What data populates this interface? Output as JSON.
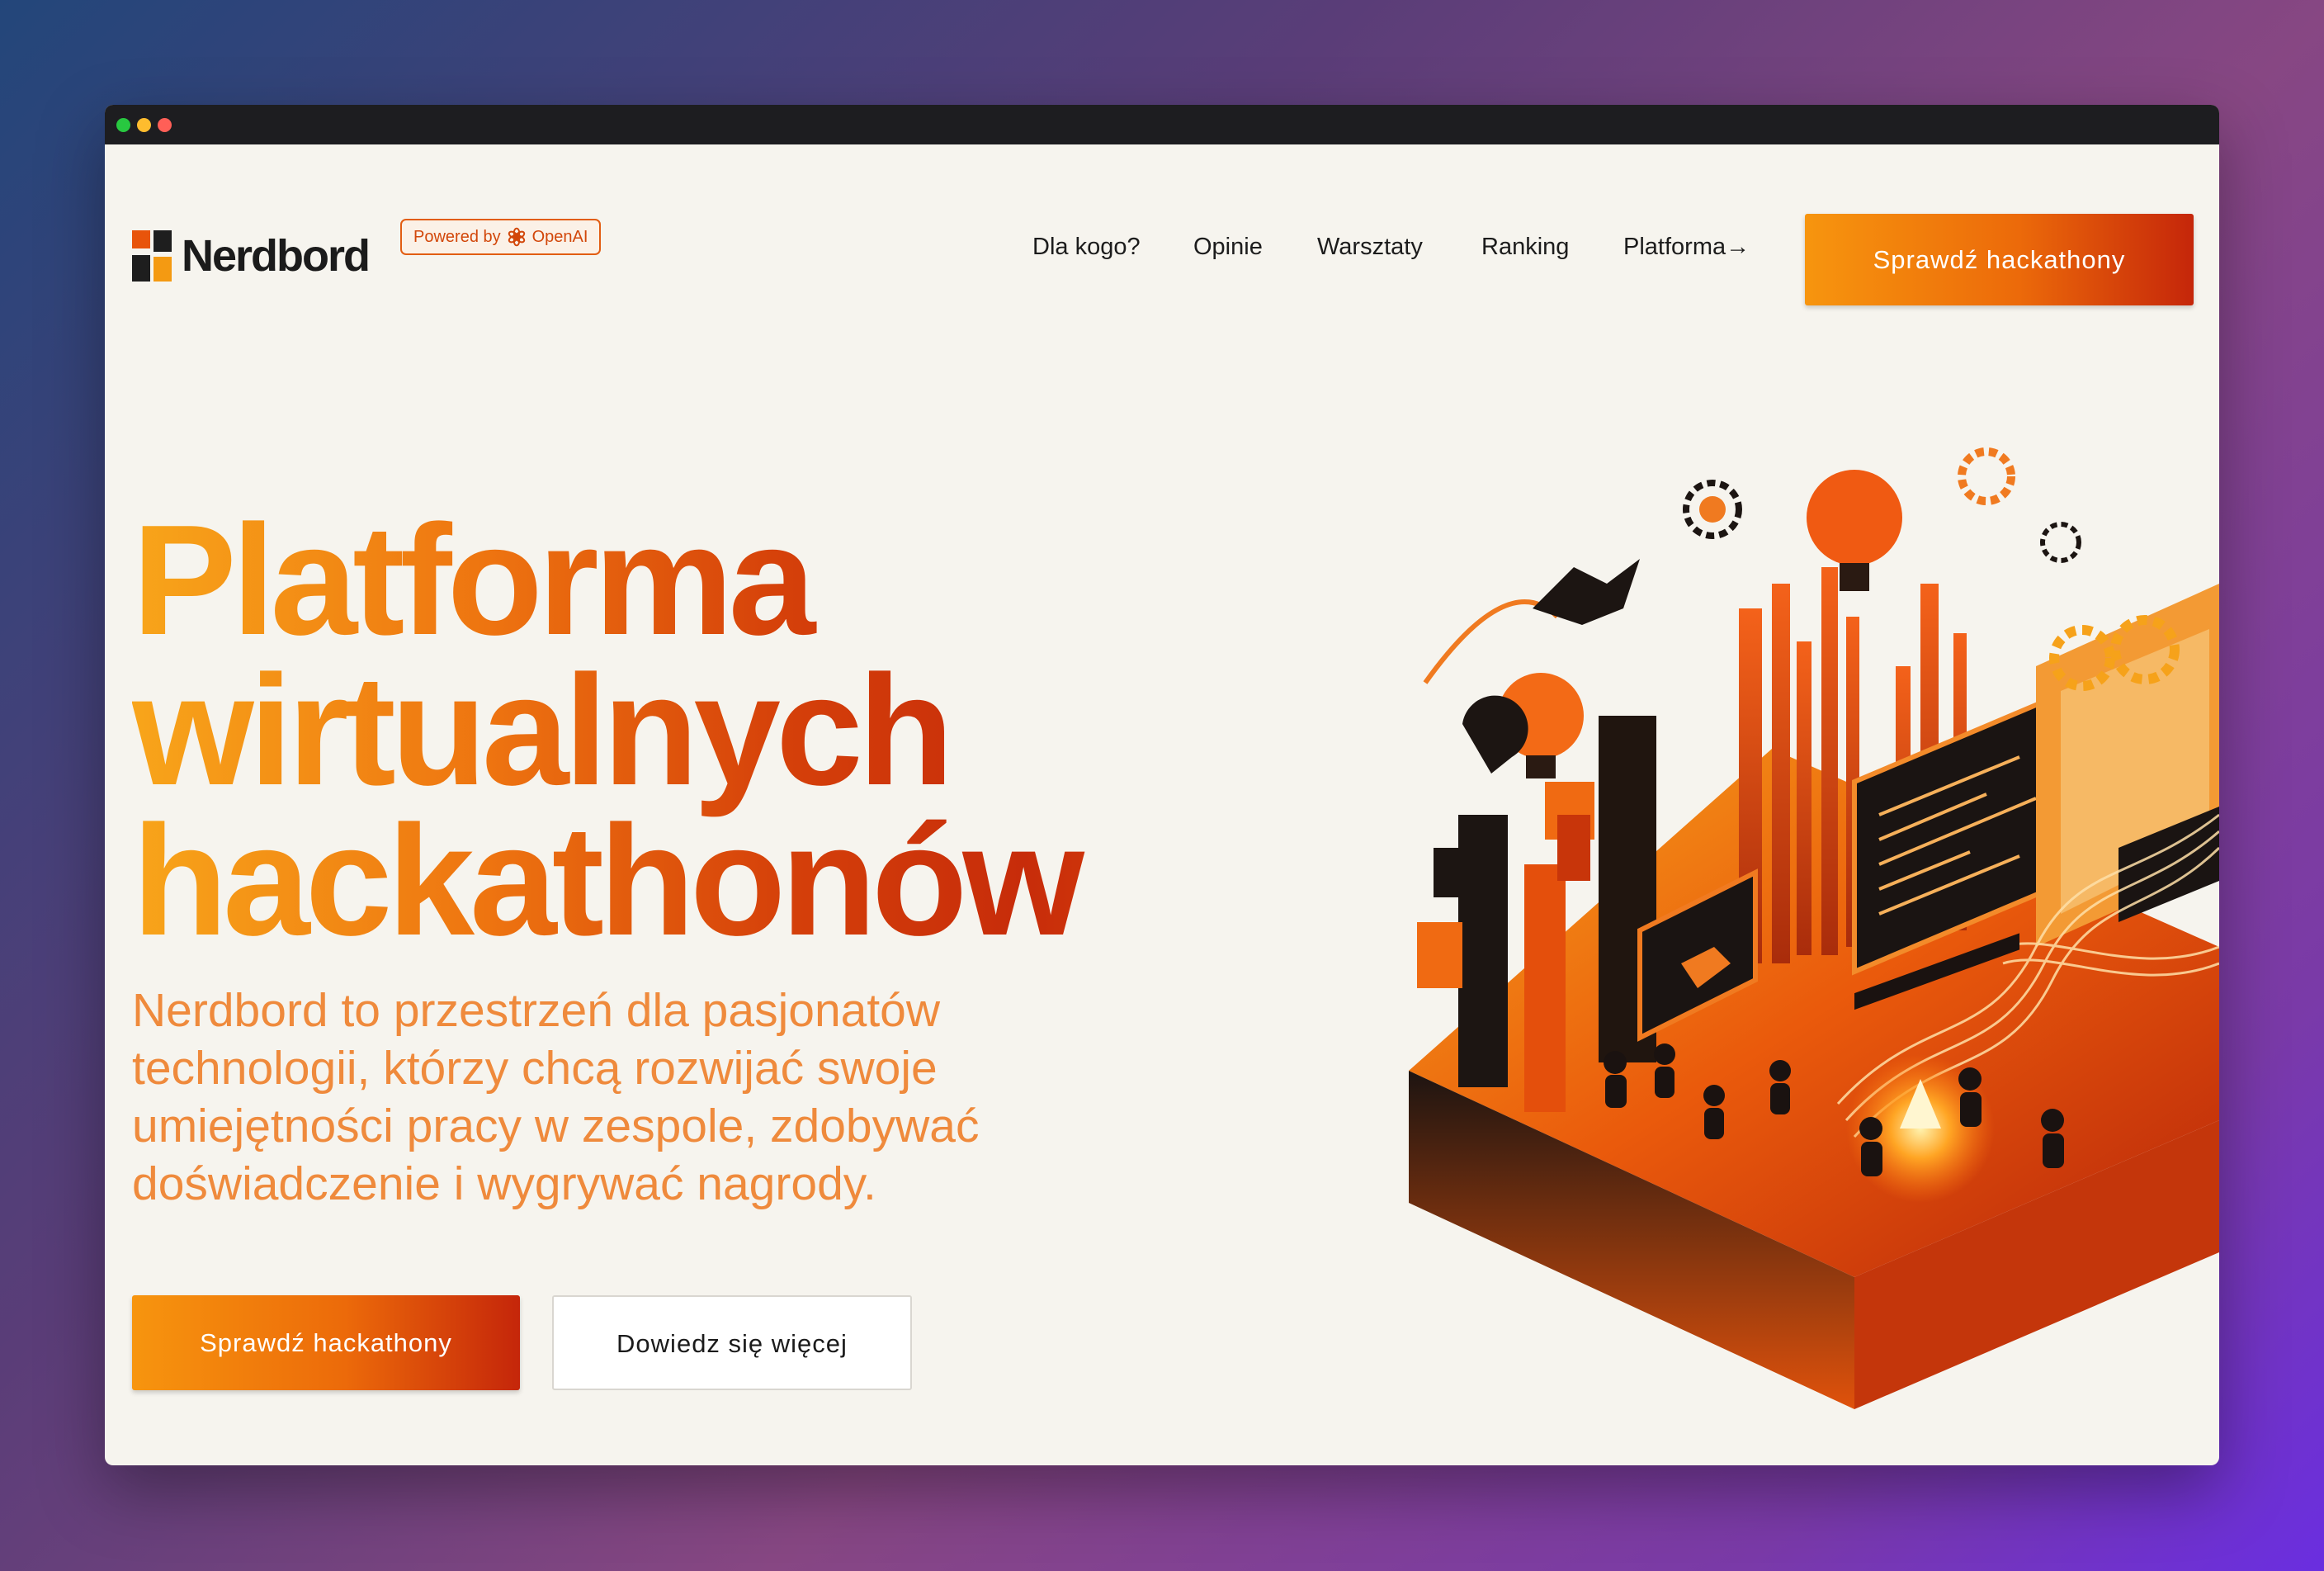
{
  "window": {
    "controls": [
      "close",
      "minimize",
      "zoom"
    ]
  },
  "header": {
    "logo_text": "Nerdbord",
    "badge": {
      "prefix": "Powered by",
      "brand": "OpenAI",
      "icon": "openai-icon"
    },
    "nav": [
      {
        "label": "Dla kogo?"
      },
      {
        "label": "Opinie"
      },
      {
        "label": "Warsztaty"
      },
      {
        "label": "Ranking"
      },
      {
        "label": "Platforma→"
      }
    ],
    "cta_label": "Sprawdź hackathony"
  },
  "hero": {
    "title_lines": [
      "Platforma",
      "wirtualnych",
      "hackathonów"
    ],
    "subtitle": "Nerdbord to przestrzeń dla pasjonatów technologii, którzy chcą rozwijać swoje umiejętności pracy w zespole, zdobywać doświadczenie i wygrywać nagrody.",
    "primary_label": "Sprawdź hackathony",
    "secondary_label": "Dowiedz się więcej",
    "illustration": "isometric-hackathon-illustration"
  },
  "colors": {
    "accent_light": "#f7950e",
    "accent_dark": "#c5260a",
    "page_background": "#f6f4ee",
    "text_dark": "#1b1b1b",
    "subtitle": "#ef8a3c"
  }
}
